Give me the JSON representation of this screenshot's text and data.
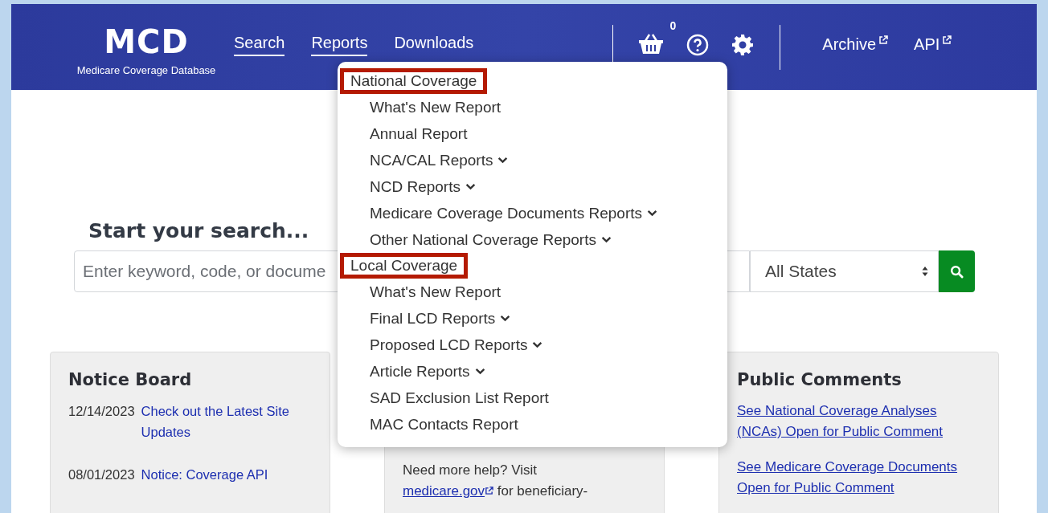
{
  "header": {
    "logo": "MCD",
    "logo_subtitle": "Medicare Coverage Database",
    "nav": [
      {
        "label": "Search",
        "underlined": true
      },
      {
        "label": "Reports",
        "underlined": true
      },
      {
        "label": "Downloads",
        "underlined": false
      }
    ],
    "cart_count": "0",
    "links": [
      {
        "label": "Archive",
        "external": true
      },
      {
        "label": "API",
        "external": true
      }
    ]
  },
  "reports_menu": {
    "groups": [
      {
        "heading": "National Coverage",
        "highlighted": true,
        "items": [
          {
            "label": "What's New Report",
            "has_submenu": false
          },
          {
            "label": "Annual Report",
            "has_submenu": false
          },
          {
            "label": "NCA/CAL Reports",
            "has_submenu": true
          },
          {
            "label": "NCD Reports",
            "has_submenu": true
          },
          {
            "label": "Medicare Coverage Documents Reports",
            "has_submenu": true
          },
          {
            "label": "Other National Coverage Reports",
            "has_submenu": true
          }
        ]
      },
      {
        "heading": "Local Coverage",
        "highlighted": true,
        "items": [
          {
            "label": "What's New Report",
            "has_submenu": false
          },
          {
            "label": "Final LCD Reports",
            "has_submenu": true
          },
          {
            "label": "Proposed LCD Reports",
            "has_submenu": true
          },
          {
            "label": "Article Reports",
            "has_submenu": true
          },
          {
            "label": "SAD Exclusion List Report",
            "has_submenu": false
          },
          {
            "label": "MAC Contacts Report",
            "has_submenu": false
          }
        ]
      }
    ]
  },
  "search": {
    "heading": "Start your search...",
    "placeholder": "Enter keyword, code, or docume",
    "state_select": "All States"
  },
  "notice_board": {
    "title": "Notice Board",
    "notices": [
      {
        "date": "12/14/2023",
        "link": "Check out the Latest Site Updates"
      },
      {
        "date": "08/01/2023",
        "link": "Notice:  Coverage API"
      }
    ]
  },
  "help_card": {
    "text_before": "Need more help? Visit",
    "link": "medicare.gov",
    "text_after": "for beneficiary-"
  },
  "public_comments": {
    "title": "Public Comments",
    "links": [
      "See National Coverage Analyses (NCAs) Open for Public Comment",
      "See Medicare Coverage Documents Open for Public Comment"
    ]
  }
}
